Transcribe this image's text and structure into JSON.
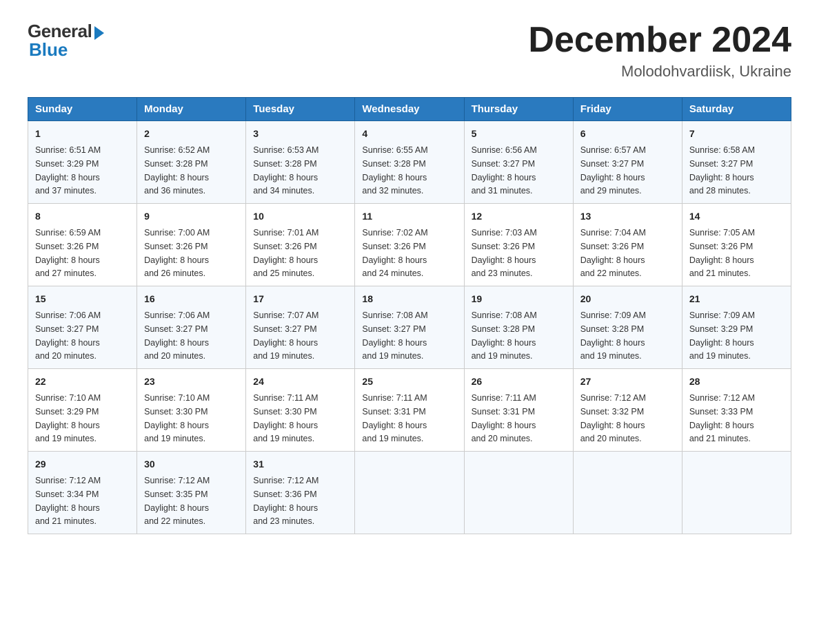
{
  "header": {
    "logo_general": "General",
    "logo_blue": "Blue",
    "month_title": "December 2024",
    "subtitle": "Molodohvardiisk, Ukraine"
  },
  "weekdays": [
    "Sunday",
    "Monday",
    "Tuesday",
    "Wednesday",
    "Thursday",
    "Friday",
    "Saturday"
  ],
  "weeks": [
    [
      {
        "day": "1",
        "sunrise": "6:51 AM",
        "sunset": "3:29 PM",
        "daylight": "8 hours and 37 minutes."
      },
      {
        "day": "2",
        "sunrise": "6:52 AM",
        "sunset": "3:28 PM",
        "daylight": "8 hours and 36 minutes."
      },
      {
        "day": "3",
        "sunrise": "6:53 AM",
        "sunset": "3:28 PM",
        "daylight": "8 hours and 34 minutes."
      },
      {
        "day": "4",
        "sunrise": "6:55 AM",
        "sunset": "3:28 PM",
        "daylight": "8 hours and 32 minutes."
      },
      {
        "day": "5",
        "sunrise": "6:56 AM",
        "sunset": "3:27 PM",
        "daylight": "8 hours and 31 minutes."
      },
      {
        "day": "6",
        "sunrise": "6:57 AM",
        "sunset": "3:27 PM",
        "daylight": "8 hours and 29 minutes."
      },
      {
        "day": "7",
        "sunrise": "6:58 AM",
        "sunset": "3:27 PM",
        "daylight": "8 hours and 28 minutes."
      }
    ],
    [
      {
        "day": "8",
        "sunrise": "6:59 AM",
        "sunset": "3:26 PM",
        "daylight": "8 hours and 27 minutes."
      },
      {
        "day": "9",
        "sunrise": "7:00 AM",
        "sunset": "3:26 PM",
        "daylight": "8 hours and 26 minutes."
      },
      {
        "day": "10",
        "sunrise": "7:01 AM",
        "sunset": "3:26 PM",
        "daylight": "8 hours and 25 minutes."
      },
      {
        "day": "11",
        "sunrise": "7:02 AM",
        "sunset": "3:26 PM",
        "daylight": "8 hours and 24 minutes."
      },
      {
        "day": "12",
        "sunrise": "7:03 AM",
        "sunset": "3:26 PM",
        "daylight": "8 hours and 23 minutes."
      },
      {
        "day": "13",
        "sunrise": "7:04 AM",
        "sunset": "3:26 PM",
        "daylight": "8 hours and 22 minutes."
      },
      {
        "day": "14",
        "sunrise": "7:05 AM",
        "sunset": "3:26 PM",
        "daylight": "8 hours and 21 minutes."
      }
    ],
    [
      {
        "day": "15",
        "sunrise": "7:06 AM",
        "sunset": "3:27 PM",
        "daylight": "8 hours and 20 minutes."
      },
      {
        "day": "16",
        "sunrise": "7:06 AM",
        "sunset": "3:27 PM",
        "daylight": "8 hours and 20 minutes."
      },
      {
        "day": "17",
        "sunrise": "7:07 AM",
        "sunset": "3:27 PM",
        "daylight": "8 hours and 19 minutes."
      },
      {
        "day": "18",
        "sunrise": "7:08 AM",
        "sunset": "3:27 PM",
        "daylight": "8 hours and 19 minutes."
      },
      {
        "day": "19",
        "sunrise": "7:08 AM",
        "sunset": "3:28 PM",
        "daylight": "8 hours and 19 minutes."
      },
      {
        "day": "20",
        "sunrise": "7:09 AM",
        "sunset": "3:28 PM",
        "daylight": "8 hours and 19 minutes."
      },
      {
        "day": "21",
        "sunrise": "7:09 AM",
        "sunset": "3:29 PM",
        "daylight": "8 hours and 19 minutes."
      }
    ],
    [
      {
        "day": "22",
        "sunrise": "7:10 AM",
        "sunset": "3:29 PM",
        "daylight": "8 hours and 19 minutes."
      },
      {
        "day": "23",
        "sunrise": "7:10 AM",
        "sunset": "3:30 PM",
        "daylight": "8 hours and 19 minutes."
      },
      {
        "day": "24",
        "sunrise": "7:11 AM",
        "sunset": "3:30 PM",
        "daylight": "8 hours and 19 minutes."
      },
      {
        "day": "25",
        "sunrise": "7:11 AM",
        "sunset": "3:31 PM",
        "daylight": "8 hours and 19 minutes."
      },
      {
        "day": "26",
        "sunrise": "7:11 AM",
        "sunset": "3:31 PM",
        "daylight": "8 hours and 20 minutes."
      },
      {
        "day": "27",
        "sunrise": "7:12 AM",
        "sunset": "3:32 PM",
        "daylight": "8 hours and 20 minutes."
      },
      {
        "day": "28",
        "sunrise": "7:12 AM",
        "sunset": "3:33 PM",
        "daylight": "8 hours and 21 minutes."
      }
    ],
    [
      {
        "day": "29",
        "sunrise": "7:12 AM",
        "sunset": "3:34 PM",
        "daylight": "8 hours and 21 minutes."
      },
      {
        "day": "30",
        "sunrise": "7:12 AM",
        "sunset": "3:35 PM",
        "daylight": "8 hours and 22 minutes."
      },
      {
        "day": "31",
        "sunrise": "7:12 AM",
        "sunset": "3:36 PM",
        "daylight": "8 hours and 23 minutes."
      },
      null,
      null,
      null,
      null
    ]
  ],
  "labels": {
    "sunrise": "Sunrise:",
    "sunset": "Sunset:",
    "daylight": "Daylight:"
  }
}
